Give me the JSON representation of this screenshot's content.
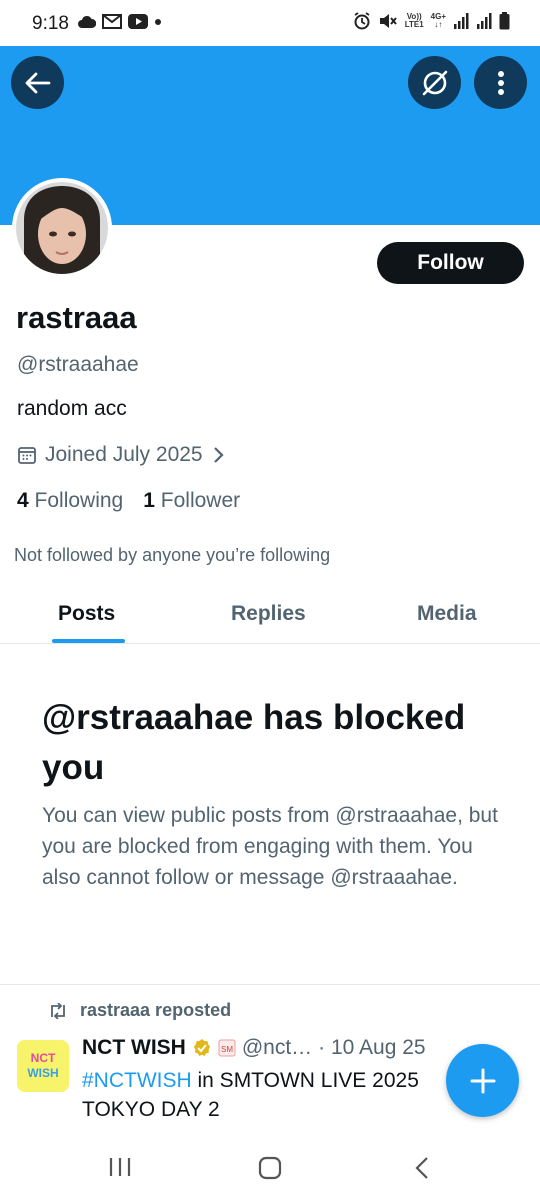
{
  "status_bar": {
    "time": "9:18",
    "left_icons": [
      "cloud-icon",
      "gmail-icon",
      "youtube-icon",
      "dot-icon"
    ],
    "right_icons": [
      "alarm-icon",
      "mute-icon",
      "volte-icon",
      "4g-icon",
      "signal-icon",
      "signal-icon",
      "battery-icon"
    ],
    "volte_label_top": "Vo))",
    "volte_label_bottom": "LTE1",
    "net_label_top": "4G+",
    "net_label_bottom": "↓↑"
  },
  "header": {
    "back_icon": "arrow-left-icon",
    "grok_icon": "grok-icon",
    "more_icon": "more-vertical-icon",
    "banner_color": "#1d9bf0"
  },
  "profile": {
    "display_name": "rastraaa",
    "handle": "@rstraaahae",
    "bio": "random acc",
    "joined": "Joined July 2025",
    "following_count": "4",
    "following_label": "Following",
    "followers_count": "1",
    "followers_label": "Follower",
    "not_followed_text": "Not followed by anyone you’re following",
    "follow_button": "Follow"
  },
  "tabs": [
    {
      "label": "Posts",
      "active": true
    },
    {
      "label": "Replies",
      "active": false
    },
    {
      "label": "Media",
      "active": false
    }
  ],
  "blocked": {
    "title": "@rstraaahae has blocked you",
    "body": "You can view public posts from @rstraaahae, but you are blocked from engaging with them. You also cannot follow or message @rstraaahae."
  },
  "post": {
    "repost_label": "rastraaa reposted",
    "author_name": "NCT WISH",
    "author_handle": "@nct…",
    "date": "· 10 Aug 25",
    "avatar_text_top": "NCT",
    "avatar_text_bottom": "WISH",
    "hashtag": "#NCTWISH",
    "text_rest": " in SMTOWN LIVE 2025 TOKYO DAY 2"
  },
  "fab": {
    "icon": "plus-icon"
  },
  "nav": {
    "icons": [
      "recents-icon",
      "home-icon",
      "back-icon"
    ]
  },
  "colors": {
    "accent": "#1d9bf0",
    "text": "#0f1419",
    "muted": "#536471"
  }
}
